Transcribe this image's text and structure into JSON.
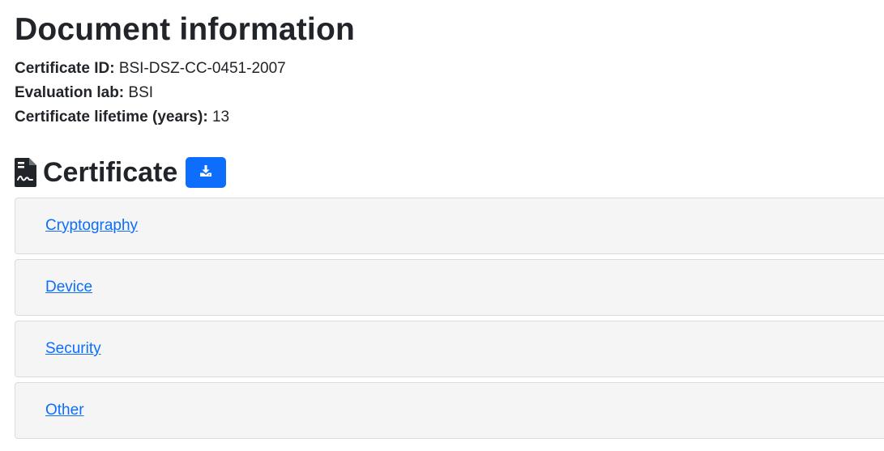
{
  "document": {
    "title": "Document information",
    "info": [
      {
        "label": "Certificate ID:",
        "value": "BSI-DSZ-CC-0451-2007"
      },
      {
        "label": "Evaluation lab:",
        "value": "BSI"
      },
      {
        "label": "Certificate lifetime (years):",
        "value": "13"
      }
    ]
  },
  "certificate": {
    "title": "Certificate",
    "icon": "file-signature-icon",
    "download_icon": "download-icon",
    "download_button_color": "#0d6efd",
    "sections": [
      {
        "label": "Cryptography"
      },
      {
        "label": "Device"
      },
      {
        "label": "Security"
      },
      {
        "label": "Other"
      }
    ]
  },
  "colors": {
    "text": "#212529",
    "link": "#0d6efd",
    "panel_bg": "#f5f5f5",
    "panel_border": "#dcdcdc"
  }
}
